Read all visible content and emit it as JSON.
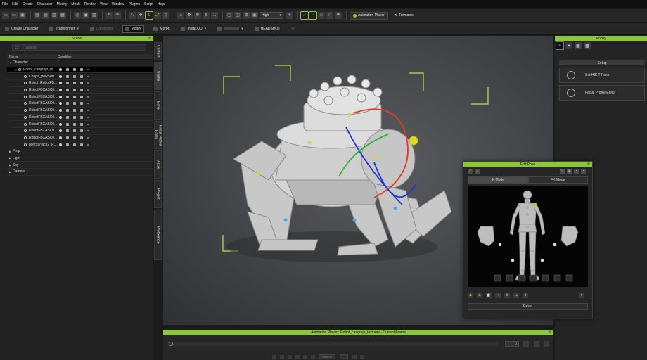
{
  "menu": [
    "File",
    "Edit",
    "Create",
    "Character",
    "Modify",
    "Mesh",
    "Render",
    "View",
    "Window",
    "Plugins",
    "Script",
    "Help"
  ],
  "toolbar1": {
    "quality": "High",
    "animation_player": "Animation Player",
    "turntable": "Turntable"
  },
  "toolbar2": {
    "create_character": "Create Character",
    "transformer": "Transformer",
    "conditions": "Conditions",
    "modify": "Modify",
    "morph": "Morph",
    "insta_lod": "InstaLOD",
    "headshot": "HEADSHOT"
  },
  "scene": {
    "title": "Scene",
    "search_placeholder": "Search",
    "col_name": "Name",
    "col_condition": "Condition",
    "rows": [
      {
        "label": "Character",
        "indent": 0,
        "arrow": "▼",
        "conditions": false,
        "selected": false
      },
      {
        "label": "Robot_cangrejo_te...",
        "indent": 1,
        "arrow": "▼",
        "conditions": true,
        "selected": true
      },
      {
        "label": "Chapa_polySurf...",
        "indent": 2,
        "arrow": "",
        "conditions": true,
        "selected": false
      },
      {
        "label": "Robot_RobotFB...",
        "indent": 2,
        "arrow": "",
        "conditions": true,
        "selected": false
      },
      {
        "label": "RobotFBXASC0...",
        "indent": 2,
        "arrow": "",
        "conditions": true,
        "selected": false
      },
      {
        "label": "RobotFBXASC0...",
        "indent": 2,
        "arrow": "",
        "conditions": true,
        "selected": false
      },
      {
        "label": "RobotFBXASC0...",
        "indent": 2,
        "arrow": "",
        "conditions": true,
        "selected": false
      },
      {
        "label": "RobotFBXASC0...",
        "indent": 2,
        "arrow": "",
        "conditions": true,
        "selected": false
      },
      {
        "label": "RobotFBXASC0...",
        "indent": 2,
        "arrow": "",
        "conditions": true,
        "selected": false
      },
      {
        "label": "RobotFBXASC0...",
        "indent": 2,
        "arrow": "",
        "conditions": true,
        "selected": false
      },
      {
        "label": "RobotFBXASC0...",
        "indent": 2,
        "arrow": "",
        "conditions": true,
        "selected": false
      },
      {
        "label": "RobotFBXASC0...",
        "indent": 2,
        "arrow": "",
        "conditions": true,
        "selected": false
      },
      {
        "label": "polySurface2_R...",
        "indent": 2,
        "arrow": "",
        "conditions": true,
        "selected": false
      },
      {
        "label": "Prop",
        "indent": 0,
        "arrow": "▶",
        "conditions": false,
        "selected": false
      },
      {
        "label": "Light",
        "indent": 0,
        "arrow": "▶",
        "conditions": false,
        "selected": false
      },
      {
        "label": "Sky",
        "indent": 0,
        "arrow": "▶",
        "conditions": false,
        "selected": false
      },
      {
        "label": "Camera",
        "indent": 0,
        "arrow": "▶",
        "conditions": false,
        "selected": false
      }
    ]
  },
  "side_tabs": [
    {
      "label": "Content",
      "h": 26,
      "selected": false
    },
    {
      "label": "Scene",
      "h": 40,
      "selected": true
    },
    {
      "label": "Bone",
      "h": 40,
      "selected": false
    },
    {
      "label": "Facial Profile Editor",
      "h": 40,
      "selected": false
    },
    {
      "label": "Visual",
      "h": 40,
      "selected": false
    },
    {
      "label": "Project",
      "h": 40,
      "selected": false
    },
    {
      "label": "Preference",
      "h": 72,
      "selected": false
    }
  ],
  "modify": {
    "title": "Modify",
    "setup": "Setup",
    "set_hik": "Set HIK T-Pose",
    "facial_profile": "Facial Profile Editor"
  },
  "edit_pose": {
    "title": "Edit Pose",
    "ik_mode": "IK Mode",
    "fk_mode": "FK Mode",
    "reset": "Reset"
  },
  "anim_player": {
    "title": "Animation Player : Robot_cangrejo_texturas - Current Frame",
    "frame": "0",
    "realtime": "Realtime"
  },
  "colors": {
    "accent": "#8cc63f",
    "selection_bg": "#000000"
  }
}
